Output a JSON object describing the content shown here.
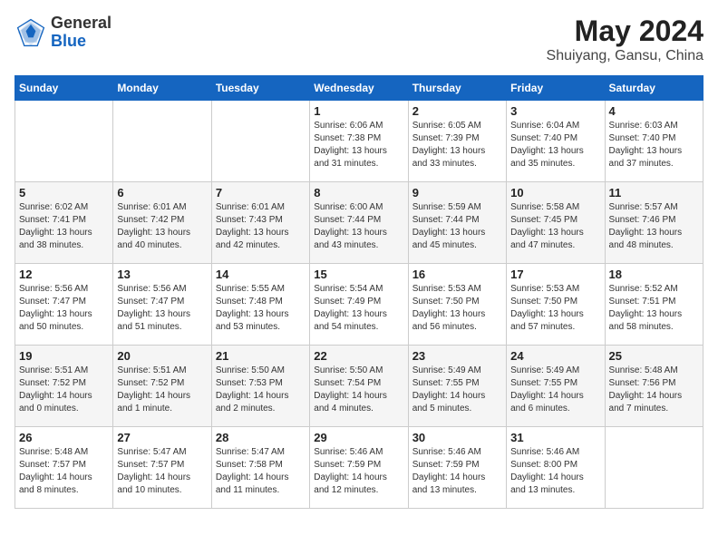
{
  "header": {
    "logo_general": "General",
    "logo_blue": "Blue",
    "month_year": "May 2024",
    "location": "Shuiyang, Gansu, China"
  },
  "days_of_week": [
    "Sunday",
    "Monday",
    "Tuesday",
    "Wednesday",
    "Thursday",
    "Friday",
    "Saturday"
  ],
  "weeks": [
    [
      {
        "day": "",
        "info": ""
      },
      {
        "day": "",
        "info": ""
      },
      {
        "day": "",
        "info": ""
      },
      {
        "day": "1",
        "info": "Sunrise: 6:06 AM\nSunset: 7:38 PM\nDaylight: 13 hours\nand 31 minutes."
      },
      {
        "day": "2",
        "info": "Sunrise: 6:05 AM\nSunset: 7:39 PM\nDaylight: 13 hours\nand 33 minutes."
      },
      {
        "day": "3",
        "info": "Sunrise: 6:04 AM\nSunset: 7:40 PM\nDaylight: 13 hours\nand 35 minutes."
      },
      {
        "day": "4",
        "info": "Sunrise: 6:03 AM\nSunset: 7:40 PM\nDaylight: 13 hours\nand 37 minutes."
      }
    ],
    [
      {
        "day": "5",
        "info": "Sunrise: 6:02 AM\nSunset: 7:41 PM\nDaylight: 13 hours\nand 38 minutes."
      },
      {
        "day": "6",
        "info": "Sunrise: 6:01 AM\nSunset: 7:42 PM\nDaylight: 13 hours\nand 40 minutes."
      },
      {
        "day": "7",
        "info": "Sunrise: 6:01 AM\nSunset: 7:43 PM\nDaylight: 13 hours\nand 42 minutes."
      },
      {
        "day": "8",
        "info": "Sunrise: 6:00 AM\nSunset: 7:44 PM\nDaylight: 13 hours\nand 43 minutes."
      },
      {
        "day": "9",
        "info": "Sunrise: 5:59 AM\nSunset: 7:44 PM\nDaylight: 13 hours\nand 45 minutes."
      },
      {
        "day": "10",
        "info": "Sunrise: 5:58 AM\nSunset: 7:45 PM\nDaylight: 13 hours\nand 47 minutes."
      },
      {
        "day": "11",
        "info": "Sunrise: 5:57 AM\nSunset: 7:46 PM\nDaylight: 13 hours\nand 48 minutes."
      }
    ],
    [
      {
        "day": "12",
        "info": "Sunrise: 5:56 AM\nSunset: 7:47 PM\nDaylight: 13 hours\nand 50 minutes."
      },
      {
        "day": "13",
        "info": "Sunrise: 5:56 AM\nSunset: 7:47 PM\nDaylight: 13 hours\nand 51 minutes."
      },
      {
        "day": "14",
        "info": "Sunrise: 5:55 AM\nSunset: 7:48 PM\nDaylight: 13 hours\nand 53 minutes."
      },
      {
        "day": "15",
        "info": "Sunrise: 5:54 AM\nSunset: 7:49 PM\nDaylight: 13 hours\nand 54 minutes."
      },
      {
        "day": "16",
        "info": "Sunrise: 5:53 AM\nSunset: 7:50 PM\nDaylight: 13 hours\nand 56 minutes."
      },
      {
        "day": "17",
        "info": "Sunrise: 5:53 AM\nSunset: 7:50 PM\nDaylight: 13 hours\nand 57 minutes."
      },
      {
        "day": "18",
        "info": "Sunrise: 5:52 AM\nSunset: 7:51 PM\nDaylight: 13 hours\nand 58 minutes."
      }
    ],
    [
      {
        "day": "19",
        "info": "Sunrise: 5:51 AM\nSunset: 7:52 PM\nDaylight: 14 hours\nand 0 minutes."
      },
      {
        "day": "20",
        "info": "Sunrise: 5:51 AM\nSunset: 7:52 PM\nDaylight: 14 hours\nand 1 minute."
      },
      {
        "day": "21",
        "info": "Sunrise: 5:50 AM\nSunset: 7:53 PM\nDaylight: 14 hours\nand 2 minutes."
      },
      {
        "day": "22",
        "info": "Sunrise: 5:50 AM\nSunset: 7:54 PM\nDaylight: 14 hours\nand 4 minutes."
      },
      {
        "day": "23",
        "info": "Sunrise: 5:49 AM\nSunset: 7:55 PM\nDaylight: 14 hours\nand 5 minutes."
      },
      {
        "day": "24",
        "info": "Sunrise: 5:49 AM\nSunset: 7:55 PM\nDaylight: 14 hours\nand 6 minutes."
      },
      {
        "day": "25",
        "info": "Sunrise: 5:48 AM\nSunset: 7:56 PM\nDaylight: 14 hours\nand 7 minutes."
      }
    ],
    [
      {
        "day": "26",
        "info": "Sunrise: 5:48 AM\nSunset: 7:57 PM\nDaylight: 14 hours\nand 8 minutes."
      },
      {
        "day": "27",
        "info": "Sunrise: 5:47 AM\nSunset: 7:57 PM\nDaylight: 14 hours\nand 10 minutes."
      },
      {
        "day": "28",
        "info": "Sunrise: 5:47 AM\nSunset: 7:58 PM\nDaylight: 14 hours\nand 11 minutes."
      },
      {
        "day": "29",
        "info": "Sunrise: 5:46 AM\nSunset: 7:59 PM\nDaylight: 14 hours\nand 12 minutes."
      },
      {
        "day": "30",
        "info": "Sunrise: 5:46 AM\nSunset: 7:59 PM\nDaylight: 14 hours\nand 13 minutes."
      },
      {
        "day": "31",
        "info": "Sunrise: 5:46 AM\nSunset: 8:00 PM\nDaylight: 14 hours\nand 13 minutes."
      },
      {
        "day": "",
        "info": ""
      }
    ]
  ]
}
